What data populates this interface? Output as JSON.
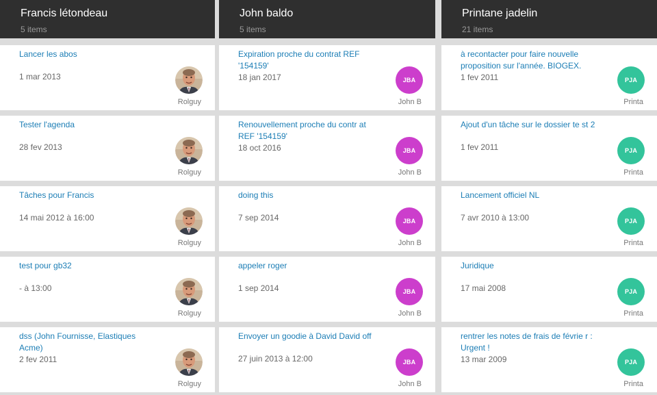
{
  "columns": [
    {
      "title": "Francis létondeau",
      "count": "5 items",
      "avatar_type": "photo",
      "cards": [
        {
          "title": "Lancer les abos",
          "date": "1 mar 2013",
          "owner": "Rolguy"
        },
        {
          "title": "Tester l'agenda",
          "date": "28 fev 2013",
          "owner": "Rolguy"
        },
        {
          "title": "Tâches pour Francis",
          "date": "14 mai 2012 à 16:00",
          "owner": "Rolguy"
        },
        {
          "title": "test pour gb32",
          "date": "- à 13:00",
          "owner": "Rolguy"
        },
        {
          "title": "dss (John Fournisse, Elastiques Acme)",
          "date": "2 fev 2011",
          "owner": "Rolguy"
        }
      ]
    },
    {
      "title": "John baldo",
      "count": "5 items",
      "avatar_type": "initials",
      "avatar_initials": "JBA",
      "avatar_color": "#cc3ecc",
      "cards": [
        {
          "title": "Expiration proche du contrat REF '154159'",
          "date": "18 jan 2017",
          "owner": "John B"
        },
        {
          "title": "Renouvellement proche du contr at REF '154159'",
          "date": "18 oct 2016",
          "owner": "John B"
        },
        {
          "title": "doing this",
          "date": "7 sep 2014",
          "owner": "John B"
        },
        {
          "title": "appeler roger",
          "date": "1 sep 2014",
          "owner": "John B"
        },
        {
          "title": "Envoyer un goodie à David David off",
          "date": "27 juin 2013 à 12:00",
          "owner": "John B"
        }
      ]
    },
    {
      "title": "Printane jadelin",
      "count": "21 items",
      "avatar_type": "initials",
      "avatar_initials": "PJA",
      "avatar_color": "#33c49b",
      "cards": [
        {
          "title": "à recontacter pour faire nouvelle proposition sur l'année. BIOGEX.",
          "date": "1 fev 2011",
          "owner": "Printa"
        },
        {
          "title": "Ajout d'un tâche sur le dossier te st 2",
          "date": "1 fev 2011",
          "owner": "Printa"
        },
        {
          "title": "Lancement officiel NL",
          "date": "7 avr 2010 à 13:00",
          "owner": "Printa"
        },
        {
          "title": "Juridique",
          "date": "17 mai 2008",
          "owner": "Printa"
        },
        {
          "title": "rentrer les notes de frais de févrie r : Urgent !",
          "date": "13 mar 2009",
          "owner": "Printa"
        }
      ]
    }
  ]
}
